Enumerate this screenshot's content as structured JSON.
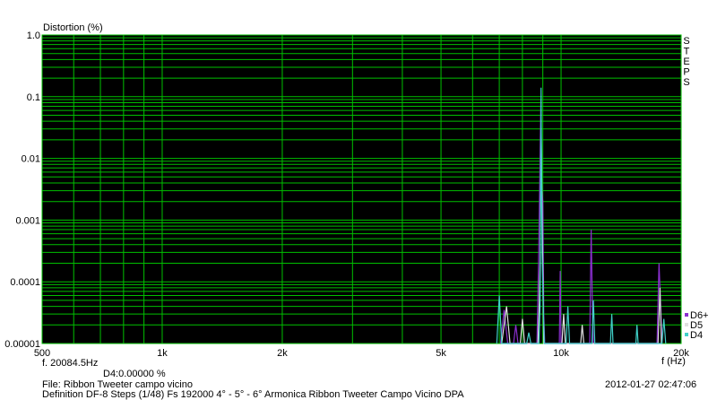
{
  "chart_data": {
    "type": "line",
    "title": "",
    "ylabel": "Distortion (%)",
    "xlabel": "f (Hz)",
    "x_scale": "log",
    "y_scale": "log",
    "xlim": [
      500,
      20000
    ],
    "ylim": [
      1e-05,
      1.0
    ],
    "x_ticks": [
      {
        "value": 500,
        "label": "500"
      },
      {
        "value": 1000,
        "label": "1k"
      },
      {
        "value": 2000,
        "label": "2k"
      },
      {
        "value": 5000,
        "label": "5k"
      },
      {
        "value": 10000,
        "label": "10k"
      },
      {
        "value": 20000,
        "label": "20k"
      }
    ],
    "y_ticks": [
      {
        "value": 1.0,
        "label": "1.0"
      },
      {
        "value": 0.1,
        "label": "0.1"
      },
      {
        "value": 0.01,
        "label": "0.01"
      },
      {
        "value": 0.001,
        "label": "0.001"
      },
      {
        "value": 0.0001,
        "label": "0.0001"
      },
      {
        "value": 1e-05,
        "label": "0.00001"
      }
    ],
    "grid": true,
    "background": "#000000",
    "grid_color": "#00c000",
    "side_label": [
      "S",
      "T",
      "E",
      "P",
      "S"
    ],
    "legend_position": "bottom-right",
    "series": [
      {
        "name": "D6+",
        "color": "#8b2fd0",
        "points": [
          [
            7050,
            1e-05
          ],
          [
            7200,
            3.5e-05
          ],
          [
            7350,
            1e-05
          ],
          [
            7600,
            1e-05
          ],
          [
            7700,
            2e-05
          ],
          [
            7800,
            1e-05
          ],
          [
            8700,
            1e-05
          ],
          [
            8780,
            0.0002
          ],
          [
            8850,
            0.006
          ],
          [
            8900,
            0.09
          ],
          [
            8950,
            0.003
          ],
          [
            9000,
            0.002
          ],
          [
            9050,
            3e-05
          ],
          [
            9100,
            1e-05
          ],
          [
            9900,
            1e-05
          ],
          [
            9950,
            0.00015
          ],
          [
            10000,
            1e-05
          ],
          [
            11800,
            1e-05
          ],
          [
            11900,
            0.0007
          ],
          [
            12000,
            2e-05
          ],
          [
            12050,
            1e-05
          ],
          [
            17400,
            1e-05
          ],
          [
            17600,
            0.0002
          ],
          [
            17800,
            3e-05
          ],
          [
            17900,
            1e-05
          ]
        ]
      },
      {
        "name": "D5",
        "color": "#e0e0e0",
        "points": [
          [
            7100,
            1e-05
          ],
          [
            7300,
            4e-05
          ],
          [
            7450,
            1e-05
          ],
          [
            7900,
            1e-05
          ],
          [
            8000,
            2.5e-05
          ],
          [
            8100,
            1e-05
          ],
          [
            8750,
            1e-05
          ],
          [
            8820,
            5e-05
          ],
          [
            8870,
            0.0003
          ],
          [
            8920,
            0.02
          ],
          [
            8980,
            0.0005
          ],
          [
            9050,
            1e-05
          ],
          [
            10050,
            1e-05
          ],
          [
            10150,
            3e-05
          ],
          [
            10250,
            1e-05
          ],
          [
            11200,
            1e-05
          ],
          [
            11300,
            2e-05
          ],
          [
            11400,
            1e-05
          ],
          [
            17500,
            1e-05
          ],
          [
            17700,
            8e-05
          ],
          [
            17850,
            1e-05
          ]
        ]
      },
      {
        "name": "D4",
        "color": "#40d0c8",
        "points": [
          [
            6900,
            1e-05
          ],
          [
            7000,
            6e-05
          ],
          [
            7100,
            1e-05
          ],
          [
            8200,
            1e-05
          ],
          [
            8300,
            1.5e-05
          ],
          [
            8400,
            1e-05
          ],
          [
            8800,
            1e-05
          ],
          [
            8860,
            4e-05
          ],
          [
            8910,
            0.14
          ],
          [
            8960,
            0.0003
          ],
          [
            9020,
            4e-05
          ],
          [
            9080,
            1e-05
          ],
          [
            10300,
            1e-05
          ],
          [
            10400,
            4e-05
          ],
          [
            10500,
            1e-05
          ],
          [
            11950,
            1e-05
          ],
          [
            12050,
            5e-05
          ],
          [
            12150,
            1e-05
          ],
          [
            13300,
            1e-05
          ],
          [
            13400,
            3e-05
          ],
          [
            13500,
            1e-05
          ],
          [
            15400,
            1e-05
          ],
          [
            15500,
            2e-05
          ],
          [
            15600,
            1e-05
          ],
          [
            17900,
            1e-05
          ],
          [
            18100,
            2.5e-05
          ],
          [
            18300,
            1e-05
          ]
        ]
      }
    ]
  },
  "cursor": {
    "freq_readout": "f. 20084.5Hz",
    "value_readout": "D4:0.00000   %"
  },
  "footer": {
    "file_line": "File: Ribbon Tweeter campo vicino",
    "definition_line": "Definition DF-8 Steps (1/48) Fs 192000 4° - 5° - 6° Armonica Ribbon Tweeter Campo Vicino    DPA",
    "timestamp": "2012-01-27 02:47:06"
  }
}
